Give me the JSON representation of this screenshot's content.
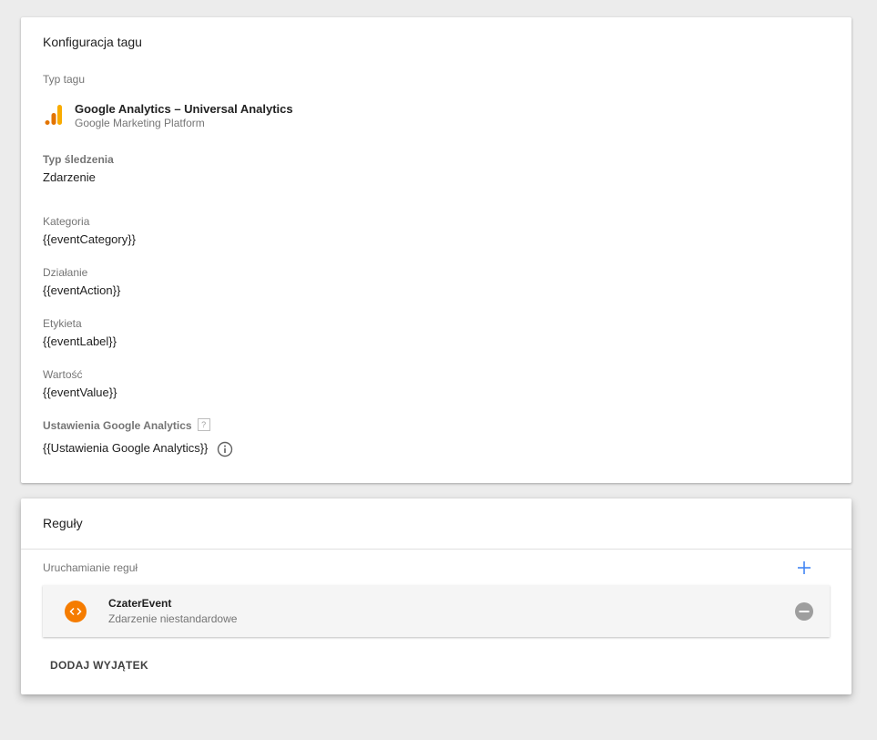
{
  "config_card": {
    "title": "Konfiguracja tagu",
    "tag_type_label": "Typ tagu",
    "tag_type": {
      "name": "Google Analytics – Universal Analytics",
      "provider": "Google Marketing Platform",
      "icon": "google-analytics-icon",
      "icon_colors": [
        "#f9ab00",
        "#e37400"
      ]
    },
    "tracking_type": {
      "label": "Typ śledzenia",
      "value": "Zdarzenie"
    },
    "fields": [
      {
        "label": "Kategoria",
        "value": "{{eventCategory}}"
      },
      {
        "label": "Działanie",
        "value": "{{eventAction}}"
      },
      {
        "label": "Etykieta",
        "value": "{{eventLabel}}"
      },
      {
        "label": "Wartość",
        "value": "{{eventValue}}"
      }
    ],
    "ga_settings": {
      "label": "Ustawienia Google Analytics",
      "help": "?",
      "value": "{{Ustawienia Google Analytics}}",
      "icon": "info-icon"
    }
  },
  "rules_card": {
    "title": "Reguły",
    "firing_label": "Uruchamianie reguł",
    "add_icon": "plus-icon",
    "accent_color": "#4285f4",
    "triggers": [
      {
        "name": "CzaterEvent",
        "type": "Zdarzenie niestandardowe",
        "icon": "code-icon",
        "icon_color": "#f57c00"
      }
    ],
    "add_exception_label": "DODAJ WYJĄTEK"
  }
}
